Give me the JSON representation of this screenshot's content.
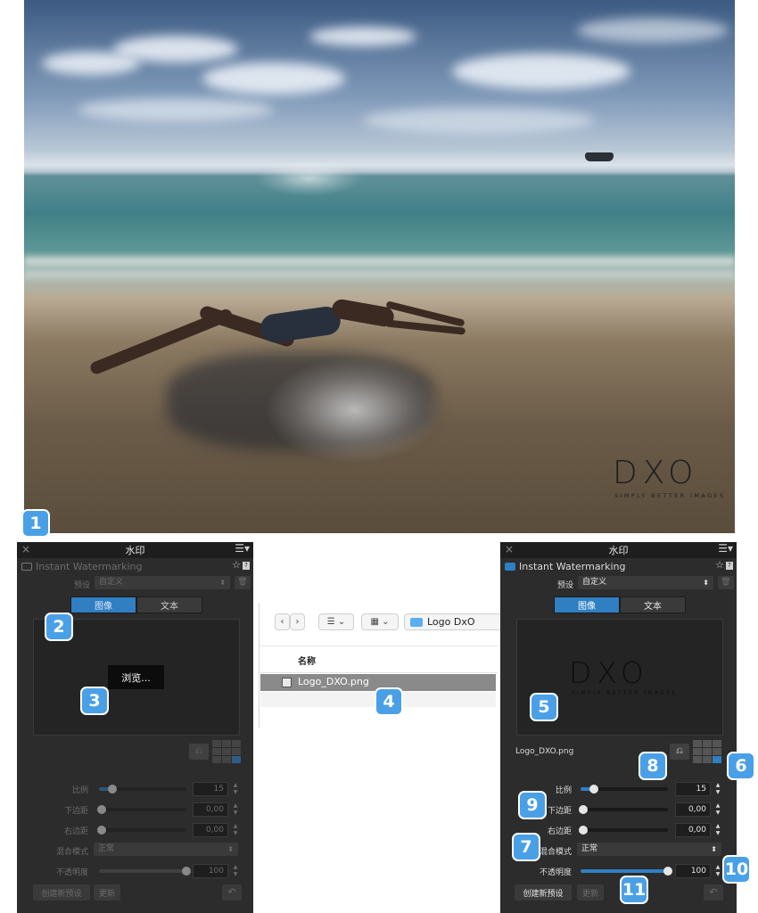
{
  "photo": {
    "watermark_logo": "DXO",
    "watermark_tagline": "SIMPLY BETTER IMAGES"
  },
  "callouts": [
    "1",
    "2",
    "3",
    "4",
    "5",
    "6",
    "7",
    "8",
    "9",
    "10",
    "11"
  ],
  "left_panel": {
    "title": "水印",
    "header": "Instant Watermarking",
    "preset_label": "预设",
    "preset_value": "自定义",
    "tab_image": "图像",
    "tab_text": "文本",
    "browse_label": "浏览...",
    "scale_label": "比例",
    "scale_value": "15",
    "bottom_margin_label": "下边距",
    "bottom_margin_value": "0,00",
    "right_margin_label": "右边距",
    "right_margin_value": "0,00",
    "blend_label": "混合模式",
    "blend_value": "正常",
    "opacity_label": "不透明度",
    "opacity_value": "100",
    "opacity": 1.0,
    "scale": 0.15,
    "create_preset": "创建新预设",
    "update": "更新"
  },
  "finder": {
    "folder_name": "Logo DxO",
    "column_name": "名称",
    "file_name": "Logo_DXO.png"
  },
  "right_panel": {
    "title": "水印",
    "header": "Instant Watermarking",
    "preset_label": "预设",
    "preset_value": "自定义",
    "tab_image": "图像",
    "tab_text": "文本",
    "preview_logo": "DXO",
    "preview_tagline": "SIMPLY BETTER IMAGES",
    "filename": "Logo_DXO.png",
    "scale_label": "比例",
    "scale_value": "15",
    "bottom_margin_label": "下边距",
    "bottom_margin_value": "0,00",
    "right_margin_label": "右边距",
    "right_margin_value": "0,00",
    "blend_label": "混合模式",
    "blend_value": "正常",
    "opacity_label": "不透明度",
    "opacity_value": "100",
    "opacity": 1.0,
    "scale": 0.15,
    "create_preset": "创建新预设",
    "update": "更新"
  },
  "colors": {
    "accent": "#2f7fc2",
    "callout": "#4aa0e6",
    "panel_bg": "#2c2c2c"
  }
}
